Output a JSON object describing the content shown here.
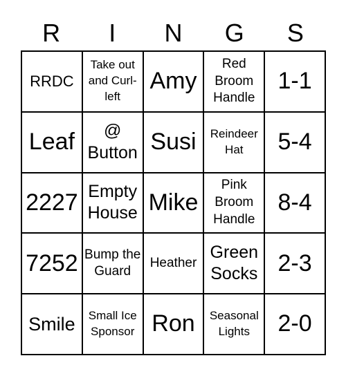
{
  "header": {
    "letters": [
      "R",
      "I",
      "N",
      "G",
      "S"
    ]
  },
  "cells": [
    [
      "RRDC",
      "Take out and Curl-left",
      "Amy",
      "Red Broom Handle",
      "1-1"
    ],
    [
      "Leaf",
      "@ Button",
      "Susi",
      "Reindeer Hat",
      "5-4"
    ],
    [
      "2227",
      "Empty House",
      "Mike",
      "Pink Broom Handle",
      "8-4"
    ],
    [
      "7252",
      "Bump the Guard",
      "Heather",
      "Green Socks",
      "2-3"
    ],
    [
      "Smile",
      "Small Ice Sponsor",
      "Ron",
      "Seasonal Lights",
      "2-0"
    ]
  ]
}
